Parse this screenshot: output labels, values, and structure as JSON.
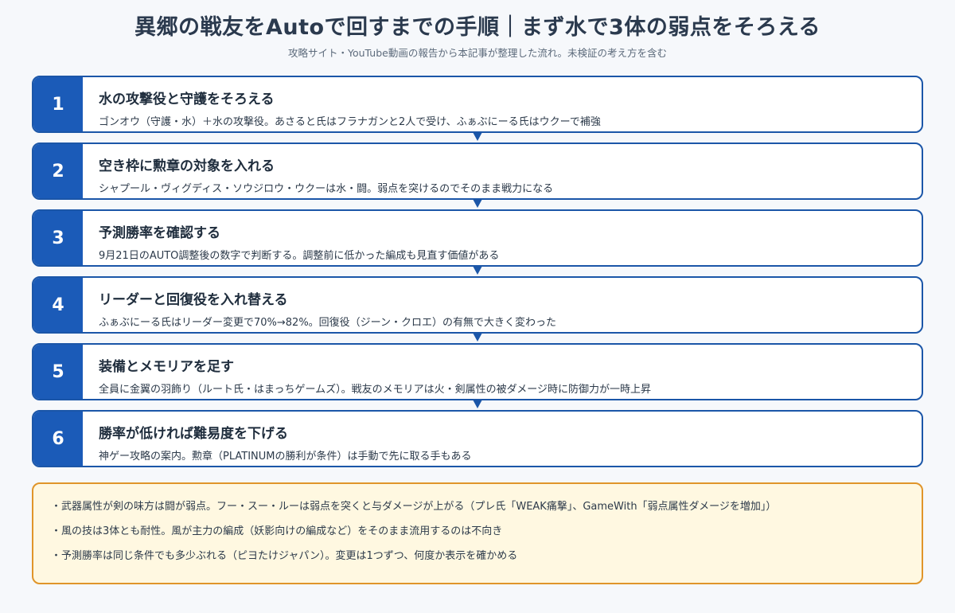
{
  "header": {
    "title": "異郷の戦友をAutoで回すまでの手順｜まず水で3体の弱点をそろえる",
    "subtitle": "攻略サイト・YouTube動画の報告から本記事が整理した流れ。未検証の考え方を含む"
  },
  "steps": [
    {
      "num": "1",
      "title": "水の攻撃役と守護をそろえる",
      "desc": "ゴンオウ（守護・水）＋水の攻撃役。あさると氏はフラナガンと2人で受け、ふぁぶにーる氏はウクーで補強"
    },
    {
      "num": "2",
      "title": "空き枠に勲章の対象を入れる",
      "desc": "シャプール・ヴィグディス・ソウジロウ・ウクーは水・闘。弱点を突けるのでそのまま戦力になる"
    },
    {
      "num": "3",
      "title": "予測勝率を確認する",
      "desc": "9月21日のAUTO調整後の数字で判断する。調整前に低かった編成も見直す価値がある"
    },
    {
      "num": "4",
      "title": "リーダーと回復役を入れ替える",
      "desc": "ふぁぶにーる氏はリーダー変更で70%→82%。回復役（ジーン・クロエ）の有無で大きく変わった"
    },
    {
      "num": "5",
      "title": "装備とメモリアを足す",
      "desc": "全員に金翼の羽飾り（ルート氏・はまっちゲームズ）。戦友のメモリアは火・剣属性の被ダメージ時に防御力が一時上昇"
    },
    {
      "num": "6",
      "title": "勝率が低ければ難易度を下げる",
      "desc": "神ゲー攻略の案内。勲章（PLATINUMの勝利が条件）は手動で先に取る手もある"
    }
  ],
  "notes": [
    "・武器属性が剣の味方は闘が弱点。フー・スー・ルーは弱点を突くと与ダメージが上がる（プレ氏「WEAK痛撃」、GameWith「弱点属性ダメージを増加」）",
    "・風の技は3体とも耐性。風が主力の編成（妖影向けの編成など）をそのまま流用するのは不向き",
    "・予測勝率は同じ条件でも多少ぶれる（ピヨたけジャパン）。変更は1つずつ、何度か表示を確かめる"
  ],
  "colors": {
    "accent": "#1b5bb8",
    "step_border": "#1b56a8",
    "note_border": "#e0952a",
    "note_bg": "#fff8e1"
  }
}
